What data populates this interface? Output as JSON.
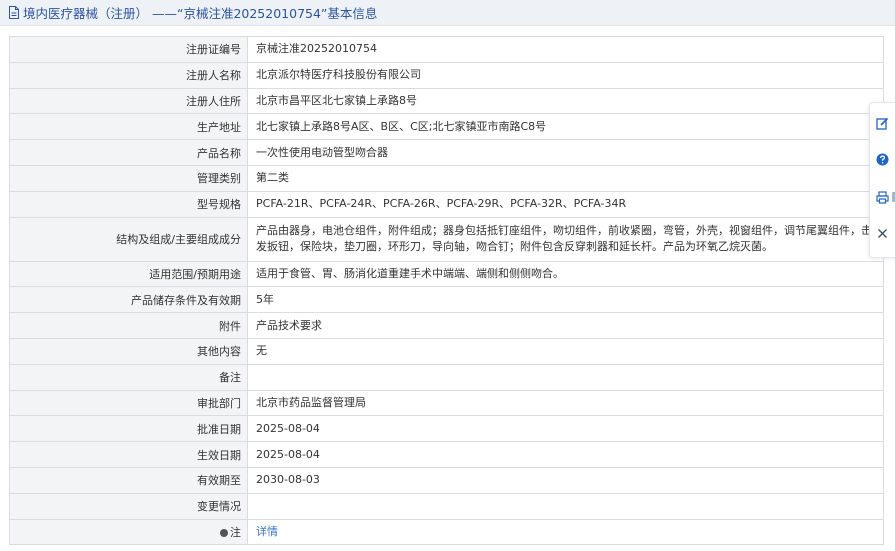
{
  "header": {
    "title": "境内医疗器械（注册） ——“京械注准20252010754”基本信息"
  },
  "rows": [
    {
      "label": "注册证编号",
      "value": "京械注准20252010754"
    },
    {
      "label": "注册人名称",
      "value": "北京派尔特医疗科技股份有限公司"
    },
    {
      "label": "注册人住所",
      "value": "北京市昌平区北七家镇上承路8号"
    },
    {
      "label": "生产地址",
      "value": "北七家镇上承路8号A区、B区、C区;北七家镇亚市南路C8号"
    },
    {
      "label": "产品名称",
      "value": "一次性使用电动管型吻合器"
    },
    {
      "label": "管理类别",
      "value": "第二类"
    },
    {
      "label": "型号规格",
      "value": "PCFA-21R、PCFA-24R、PCFA-26R、PCFA-29R、PCFA-32R、PCFA-34R"
    },
    {
      "label": "结构及组成/主要组成成分",
      "value": "产品由器身，电池仓组件，附件组成；器身包括抵钉座组件，吻切组件，前收紧圈，弯管，外壳，视窗组件，调节尾翼组件，击发扳钮，保险块，垫刀圈，环形刀，导向轴，吻合钉；附件包含反穿刺器和延长杆。产品为环氧乙烷灭菌。"
    },
    {
      "label": "适用范围/预期用途",
      "value": "适用于食管、胃、肠消化道重建手术中端端、端侧和侧侧吻合。"
    },
    {
      "label": "产品储存条件及有效期",
      "value": "5年"
    },
    {
      "label": "附件",
      "value": "产品技术要求"
    },
    {
      "label": "其他内容",
      "value": "无"
    },
    {
      "label": "备注",
      "value": ""
    },
    {
      "label": "审批部门",
      "value": "北京市药品监督管理局"
    },
    {
      "label": "批准日期",
      "value": "2025-08-04"
    },
    {
      "label": "生效日期",
      "value": "2025-08-04"
    },
    {
      "label": "有效期至",
      "value": "2030-08-03"
    },
    {
      "label": "变更情况",
      "value": ""
    }
  ],
  "note_row": {
    "label": "注",
    "link": "详情"
  },
  "sidepanel": {
    "buttons": [
      {
        "icon": "edit-icon"
      },
      {
        "icon": "help-icon"
      },
      {
        "icon": "print-icon"
      },
      {
        "icon": "close-icon"
      }
    ],
    "accent": "#1f64c8"
  },
  "colors": {
    "title_text": "#2a55a5",
    "label_bg": "#f3f4f6",
    "border": "#d9dde3",
    "link": "#3a72c7"
  }
}
